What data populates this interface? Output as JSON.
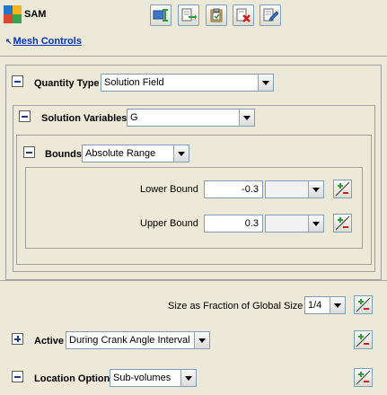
{
  "app": {
    "title": "SAM"
  },
  "toolbar": {
    "buttons": [
      {
        "icon": "tool-field-icon"
      },
      {
        "icon": "export-icon"
      },
      {
        "icon": "paste-icon"
      },
      {
        "icon": "delete-icon"
      },
      {
        "icon": "edit-icon"
      }
    ]
  },
  "nav": {
    "mesh_controls": "Mesh Controls"
  },
  "quantity_type": {
    "label": "Quantity Type",
    "value": "Solution Field"
  },
  "solution_variables": {
    "label": "Solution Variables",
    "value": "G"
  },
  "bounds": {
    "label": "Bounds",
    "value": "Absolute Range",
    "lower_label": "Lower Bound",
    "lower_value": "-0.3",
    "lower_unit": "",
    "upper_label": "Upper Bound",
    "upper_value": "0.3",
    "upper_unit": ""
  },
  "size_fraction": {
    "label": "Size as Fraction of Global Size",
    "value": "1/4"
  },
  "active": {
    "label": "Active",
    "value": "During Crank Angle Interval"
  },
  "location_option": {
    "label": "Location Option",
    "value": "Sub-volumes"
  },
  "colors": {
    "link": "#0033cc",
    "background": "#ece9d8",
    "accent_green": "#2e9b3a",
    "accent_red": "#d21e1e"
  }
}
